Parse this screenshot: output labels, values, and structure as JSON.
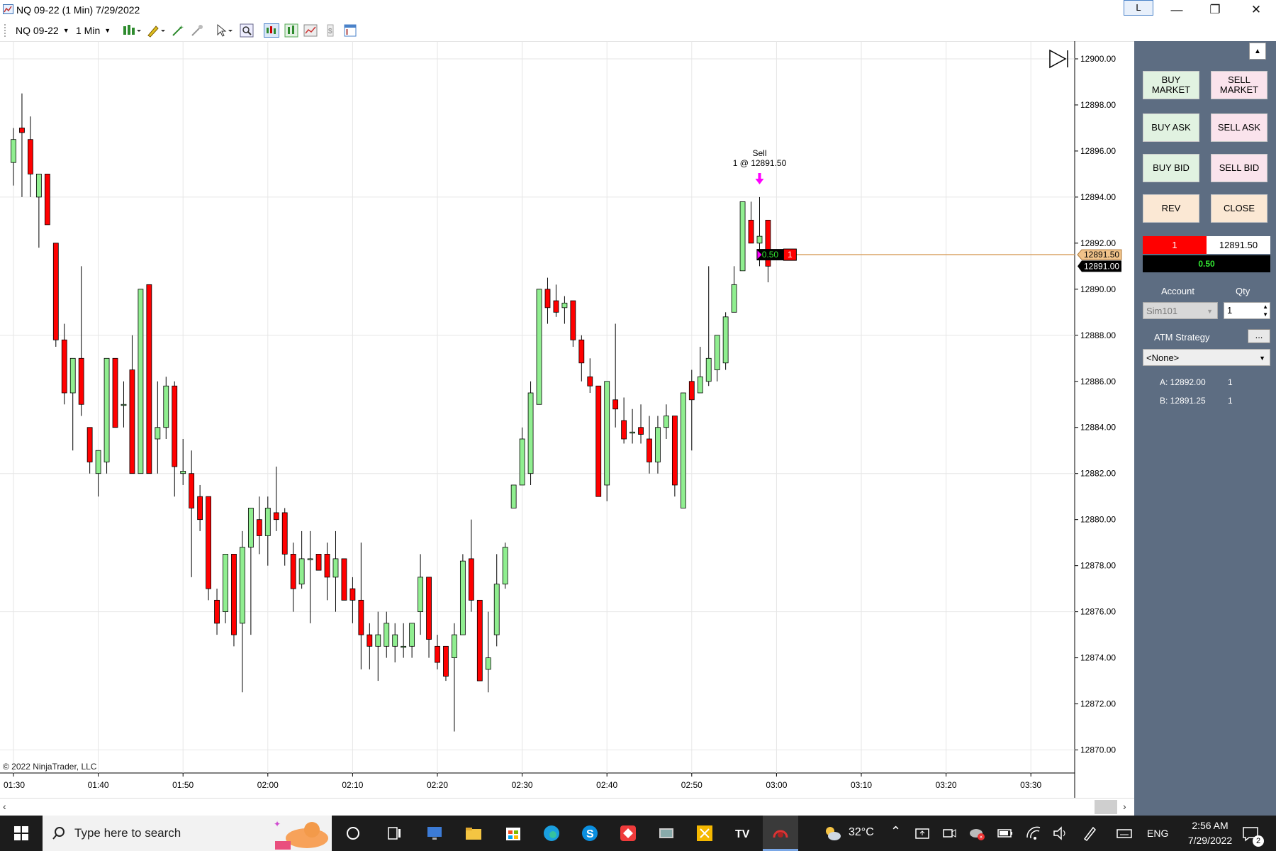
{
  "window": {
    "title": "NQ 09-22 (1 Min)  7/29/2022",
    "link_label": "L",
    "minimize": "—",
    "restore": "❐",
    "close": "✕"
  },
  "toolbar": {
    "instrument": "NQ 09-22",
    "interval": "1 Min"
  },
  "chart_data": {
    "type": "candlestick",
    "ylim": [
      12869,
      12900.4
    ],
    "ytick_labels": [
      "12900.00",
      "12898.00",
      "12896.00",
      "12894.00",
      "12892.00",
      "12890.00",
      "12888.00",
      "12886.00",
      "12884.00",
      "12882.00",
      "12880.00",
      "12878.00",
      "12876.00",
      "12874.00",
      "12872.00",
      "12870.00"
    ],
    "ytick_values": [
      12900,
      12898,
      12896,
      12894,
      12892,
      12890,
      12888,
      12886,
      12884,
      12882,
      12880,
      12878,
      12876,
      12874,
      12872,
      12870
    ],
    "xtick_labels": [
      "01:30",
      "01:40",
      "01:50",
      "02:00",
      "02:10",
      "02:20",
      "02:30",
      "02:40",
      "02:50",
      "03:00",
      "03:10",
      "03:20",
      "03:30"
    ],
    "xtick_minutes": [
      0,
      10,
      20,
      30,
      40,
      50,
      60,
      70,
      80,
      90,
      100,
      110,
      120
    ],
    "colors": {
      "up": "#90ee90",
      "down": "#ff0000",
      "wick": "#000000",
      "grid": "#e6e6e6"
    },
    "candles": [
      {
        "t": 0,
        "o": 12895.5,
        "h": 12897.0,
        "l": 12894.5,
        "c": 12896.5
      },
      {
        "t": 1,
        "o": 12897.0,
        "h": 12898.5,
        "l": 12894.0,
        "c": 12896.8
      },
      {
        "t": 2,
        "o": 12896.5,
        "h": 12897.5,
        "l": 12894.0,
        "c": 12895.0
      },
      {
        "t": 3,
        "o": 12894.0,
        "h": 12895.0,
        "l": 12891.8,
        "c": 12895.0
      },
      {
        "t": 4,
        "o": 12895.0,
        "h": 12895.0,
        "l": 12892.8,
        "c": 12892.8
      },
      {
        "t": 5,
        "o": 12892.0,
        "h": 12892.0,
        "l": 12887.5,
        "c": 12887.8
      },
      {
        "t": 6,
        "o": 12887.8,
        "h": 12888.5,
        "l": 12885.0,
        "c": 12885.5
      },
      {
        "t": 7,
        "o": 12885.5,
        "h": 12886.5,
        "l": 12883.0,
        "c": 12887.0
      },
      {
        "t": 8,
        "o": 12887.0,
        "h": 12891.0,
        "l": 12884.5,
        "c": 12885.0
      },
      {
        "t": 9,
        "o": 12884.0,
        "h": 12884.0,
        "l": 12882.0,
        "c": 12882.5
      },
      {
        "t": 10,
        "o": 12882.0,
        "h": 12883.0,
        "l": 12881.0,
        "c": 12883.0
      },
      {
        "t": 11,
        "o": 12882.5,
        "h": 12887.0,
        "l": 12882.0,
        "c": 12887.0
      },
      {
        "t": 12,
        "o": 12887.0,
        "h": 12887.0,
        "l": 12884.0,
        "c": 12884.0
      },
      {
        "t": 13,
        "o": 12885.0,
        "h": 12886.0,
        "l": 12884.0,
        "c": 12885.0
      },
      {
        "t": 14,
        "o": 12886.5,
        "h": 12888.0,
        "l": 12882.0,
        "c": 12882.0
      },
      {
        "t": 15,
        "o": 12882.0,
        "h": 12890.0,
        "l": 12882.0,
        "c": 12890.0
      },
      {
        "t": 16,
        "o": 12890.2,
        "h": 12890.2,
        "l": 12882.0,
        "c": 12882.0
      },
      {
        "t": 17,
        "o": 12883.5,
        "h": 12886.0,
        "l": 12882.0,
        "c": 12884.0
      },
      {
        "t": 18,
        "o": 12884.0,
        "h": 12886.2,
        "l": 12883.5,
        "c": 12885.8
      },
      {
        "t": 19,
        "o": 12885.8,
        "h": 12886.0,
        "l": 12881.0,
        "c": 12882.3
      },
      {
        "t": 20,
        "o": 12882.0,
        "h": 12883.5,
        "l": 12881.5,
        "c": 12882.1
      },
      {
        "t": 21,
        "o": 12882.0,
        "h": 12883.0,
        "l": 12877.5,
        "c": 12880.5
      },
      {
        "t": 22,
        "o": 12881.0,
        "h": 12881.5,
        "l": 12879.5,
        "c": 12880.0
      },
      {
        "t": 23,
        "o": 12881.0,
        "h": 12881.0,
        "l": 12876.5,
        "c": 12877.0
      },
      {
        "t": 24,
        "o": 12876.5,
        "h": 12877.0,
        "l": 12875.0,
        "c": 12875.5
      },
      {
        "t": 25,
        "o": 12876.0,
        "h": 12878.5,
        "l": 12875.5,
        "c": 12878.5
      },
      {
        "t": 26,
        "o": 12878.5,
        "h": 12878.5,
        "l": 12874.5,
        "c": 12875.0
      },
      {
        "t": 27,
        "o": 12875.5,
        "h": 12879.5,
        "l": 12872.5,
        "c": 12878.8
      },
      {
        "t": 28,
        "o": 12878.8,
        "h": 12880.5,
        "l": 12875.0,
        "c": 12880.5
      },
      {
        "t": 29,
        "o": 12880.0,
        "h": 12881.0,
        "l": 12878.5,
        "c": 12879.3
      },
      {
        "t": 30,
        "o": 12879.3,
        "h": 12881.0,
        "l": 12878.0,
        "c": 12880.5
      },
      {
        "t": 31,
        "o": 12880.3,
        "h": 12882.3,
        "l": 12879.5,
        "c": 12880.0
      },
      {
        "t": 32,
        "o": 12880.3,
        "h": 12880.5,
        "l": 12878.0,
        "c": 12878.5
      },
      {
        "t": 33,
        "o": 12878.5,
        "h": 12879.0,
        "l": 12876.0,
        "c": 12877.0
      },
      {
        "t": 34,
        "o": 12877.2,
        "h": 12879.5,
        "l": 12877.0,
        "c": 12878.3
      },
      {
        "t": 35,
        "o": 12878.3,
        "h": 12879.5,
        "l": 12875.5,
        "c": 12878.3
      },
      {
        "t": 36,
        "o": 12878.5,
        "h": 12878.5,
        "l": 12877.8,
        "c": 12877.8
      },
      {
        "t": 37,
        "o": 12878.5,
        "h": 12879.0,
        "l": 12876.5,
        "c": 12877.5
      },
      {
        "t": 38,
        "o": 12877.5,
        "h": 12879.5,
        "l": 12876.0,
        "c": 12878.3
      },
      {
        "t": 39,
        "o": 12878.3,
        "h": 12878.3,
        "l": 12876.5,
        "c": 12876.5
      },
      {
        "t": 40,
        "o": 12877.0,
        "h": 12877.5,
        "l": 12875.5,
        "c": 12876.5
      },
      {
        "t": 41,
        "o": 12876.5,
        "h": 12879.0,
        "l": 12873.5,
        "c": 12875.0
      },
      {
        "t": 42,
        "o": 12875.0,
        "h": 12875.5,
        "l": 12873.5,
        "c": 12874.5
      },
      {
        "t": 43,
        "o": 12874.5,
        "h": 12876.0,
        "l": 12873.0,
        "c": 12875.0
      },
      {
        "t": 44,
        "o": 12874.5,
        "h": 12876.0,
        "l": 12874.0,
        "c": 12875.5
      },
      {
        "t": 45,
        "o": 12874.5,
        "h": 12875.5,
        "l": 12873.8,
        "c": 12875.0
      },
      {
        "t": 46,
        "o": 12874.5,
        "h": 12875.5,
        "l": 12874.0,
        "c": 12874.5
      },
      {
        "t": 47,
        "o": 12874.5,
        "h": 12875.5,
        "l": 12874.0,
        "c": 12875.5
      },
      {
        "t": 48,
        "o": 12876.0,
        "h": 12878.5,
        "l": 12875.0,
        "c": 12877.5
      },
      {
        "t": 49,
        "o": 12877.5,
        "h": 12877.5,
        "l": 12874.0,
        "c": 12874.8
      },
      {
        "t": 50,
        "o": 12874.5,
        "h": 12875.0,
        "l": 12873.5,
        "c": 12873.8
      },
      {
        "t": 51,
        "o": 12874.5,
        "h": 12874.5,
        "l": 12873.0,
        "c": 12873.2
      },
      {
        "t": 52,
        "o": 12874.0,
        "h": 12875.5,
        "l": 12870.8,
        "c": 12875.0
      },
      {
        "t": 53,
        "o": 12875.0,
        "h": 12878.5,
        "l": 12875.0,
        "c": 12878.2
      },
      {
        "t": 54,
        "o": 12878.3,
        "h": 12880.0,
        "l": 12876.0,
        "c": 12876.5
      },
      {
        "t": 55,
        "o": 12876.5,
        "h": 12876.5,
        "l": 12873.0,
        "c": 12873.0
      },
      {
        "t": 56,
        "o": 12873.5,
        "h": 12876.0,
        "l": 12872.5,
        "c": 12874.0
      },
      {
        "t": 57,
        "o": 12875.0,
        "h": 12878.5,
        "l": 12874.5,
        "c": 12877.2
      },
      {
        "t": 58,
        "o": 12877.2,
        "h": 12879.0,
        "l": 12877.0,
        "c": 12878.8
      },
      {
        "t": 59,
        "o": 12880.5,
        "h": 12881.5,
        "l": 12880.5,
        "c": 12881.5
      },
      {
        "t": 60,
        "o": 12881.5,
        "h": 12884.0,
        "l": 12881.5,
        "c": 12883.5
      },
      {
        "t": 61,
        "o": 12882.0,
        "h": 12886.0,
        "l": 12881.5,
        "c": 12885.5
      },
      {
        "t": 62,
        "o": 12885.0,
        "h": 12890.0,
        "l": 12885.0,
        "c": 12890.0
      },
      {
        "t": 63,
        "o": 12890.0,
        "h": 12890.5,
        "l": 12888.5,
        "c": 12889.2
      },
      {
        "t": 64,
        "o": 12889.5,
        "h": 12890.2,
        "l": 12888.8,
        "c": 12889.0
      },
      {
        "t": 65,
        "o": 12889.2,
        "h": 12889.7,
        "l": 12888.5,
        "c": 12889.4
      },
      {
        "t": 66,
        "o": 12889.5,
        "h": 12889.5,
        "l": 12887.5,
        "c": 12887.8
      },
      {
        "t": 67,
        "o": 12887.8,
        "h": 12888.0,
        "l": 12886.0,
        "c": 12886.8
      },
      {
        "t": 68,
        "o": 12886.2,
        "h": 12887.0,
        "l": 12885.5,
        "c": 12885.8
      },
      {
        "t": 69,
        "o": 12885.8,
        "h": 12885.8,
        "l": 12881.0,
        "c": 12881.0
      },
      {
        "t": 70,
        "o": 12881.5,
        "h": 12886.0,
        "l": 12880.8,
        "c": 12886.0
      },
      {
        "t": 71,
        "o": 12885.2,
        "h": 12888.5,
        "l": 12884.0,
        "c": 12884.8
      },
      {
        "t": 72,
        "o": 12884.3,
        "h": 12885.3,
        "l": 12883.3,
        "c": 12883.5
      },
      {
        "t": 73,
        "o": 12883.8,
        "h": 12884.8,
        "l": 12883.3,
        "c": 12883.8
      },
      {
        "t": 74,
        "o": 12884.0,
        "h": 12885.0,
        "l": 12883.3,
        "c": 12883.7
      },
      {
        "t": 75,
        "o": 12883.5,
        "h": 12884.5,
        "l": 12882.0,
        "c": 12882.5
      },
      {
        "t": 76,
        "o": 12882.5,
        "h": 12884.5,
        "l": 12882.0,
        "c": 12884.0
      },
      {
        "t": 77,
        "o": 12884.0,
        "h": 12885.0,
        "l": 12883.5,
        "c": 12884.5
      },
      {
        "t": 78,
        "o": 12884.5,
        "h": 12884.5,
        "l": 12881.0,
        "c": 12881.5
      },
      {
        "t": 79,
        "o": 12880.5,
        "h": 12885.5,
        "l": 12880.5,
        "c": 12885.5
      },
      {
        "t": 80,
        "o": 12886.0,
        "h": 12886.5,
        "l": 12883.0,
        "c": 12885.2
      },
      {
        "t": 81,
        "o": 12885.5,
        "h": 12887.5,
        "l": 12885.5,
        "c": 12886.2
      },
      {
        "t": 82,
        "o": 12886.0,
        "h": 12891.0,
        "l": 12885.8,
        "c": 12887.0
      },
      {
        "t": 83,
        "o": 12886.5,
        "h": 12888.0,
        "l": 12886.0,
        "c": 12888.0
      },
      {
        "t": 84,
        "o": 12886.8,
        "h": 12889.0,
        "l": 12886.5,
        "c": 12888.8
      },
      {
        "t": 85,
        "o": 12889.0,
        "h": 12891.0,
        "l": 12889.0,
        "c": 12890.2
      },
      {
        "t": 86,
        "o": 12890.8,
        "h": 12893.8,
        "l": 12891.0,
        "c": 12893.8
      },
      {
        "t": 87,
        "o": 12893.0,
        "h": 12893.8,
        "l": 12892.0,
        "c": 12892.0
      },
      {
        "t": 88,
        "o": 12892.0,
        "h": 12894.0,
        "l": 12891.0,
        "c": 12892.3
      },
      {
        "t": 89,
        "o": 12893.0,
        "h": 12893.0,
        "l": 12890.3,
        "c": 12891.0
      }
    ],
    "price_marker": {
      "price": 12891.5,
      "label": "12891.50"
    },
    "last_price": {
      "price": 12891.0,
      "label": "12891.00"
    },
    "position": {
      "pnl": "0.50",
      "qty": "1"
    },
    "execution": {
      "side": "Sell",
      "detail": "1 @ 12891.50",
      "t": 88
    },
    "copyright": "© 2022 NinjaTrader, LLC"
  },
  "panel": {
    "buy_market": "BUY\nMARKET",
    "sell_market": "SELL\nMARKET",
    "buy_ask": "BUY ASK",
    "sell_ask": "SELL ASK",
    "buy_bid": "BUY BID",
    "sell_bid": "SELL BID",
    "rev": "REV",
    "close": "CLOSE",
    "position_qty": "1",
    "position_price": "12891.50",
    "pnl": "0.50",
    "account_label": "Account",
    "qty_label": "Qty",
    "account_value": "Sim101",
    "qty_value": "1",
    "atm_label": "ATM Strategy",
    "atm_btn": "...",
    "atm_value": "<None>",
    "ask_line": "A: 12892.00",
    "ask_qty": "1",
    "bid_line": "B: 12891.25",
    "bid_qty": "1"
  },
  "taskbar": {
    "search_placeholder": "Type here to search",
    "temperature": "32°C",
    "language": "ENG",
    "time": "2:56 AM",
    "date": "7/29/2022",
    "notifications": "2"
  }
}
